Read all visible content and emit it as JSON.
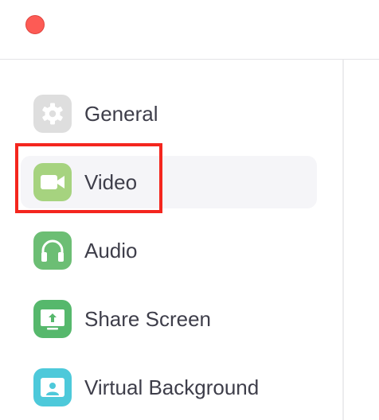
{
  "window": {
    "close_button_color": "#fd5b55"
  },
  "sidebar": {
    "selected_index": 1,
    "items": [
      {
        "label": "General",
        "icon": "gear-icon",
        "color": "#dedede"
      },
      {
        "label": "Video",
        "icon": "video-camera-icon",
        "color": "#a6d37f"
      },
      {
        "label": "Audio",
        "icon": "headphones-icon",
        "color": "#6cbe74"
      },
      {
        "label": "Share Screen",
        "icon": "share-screen-icon",
        "color": "#56b86c"
      },
      {
        "label": "Virtual Background",
        "icon": "person-background-icon",
        "color": "#4dc9da"
      }
    ]
  },
  "annotation": {
    "highlight_color": "#f4261e"
  }
}
